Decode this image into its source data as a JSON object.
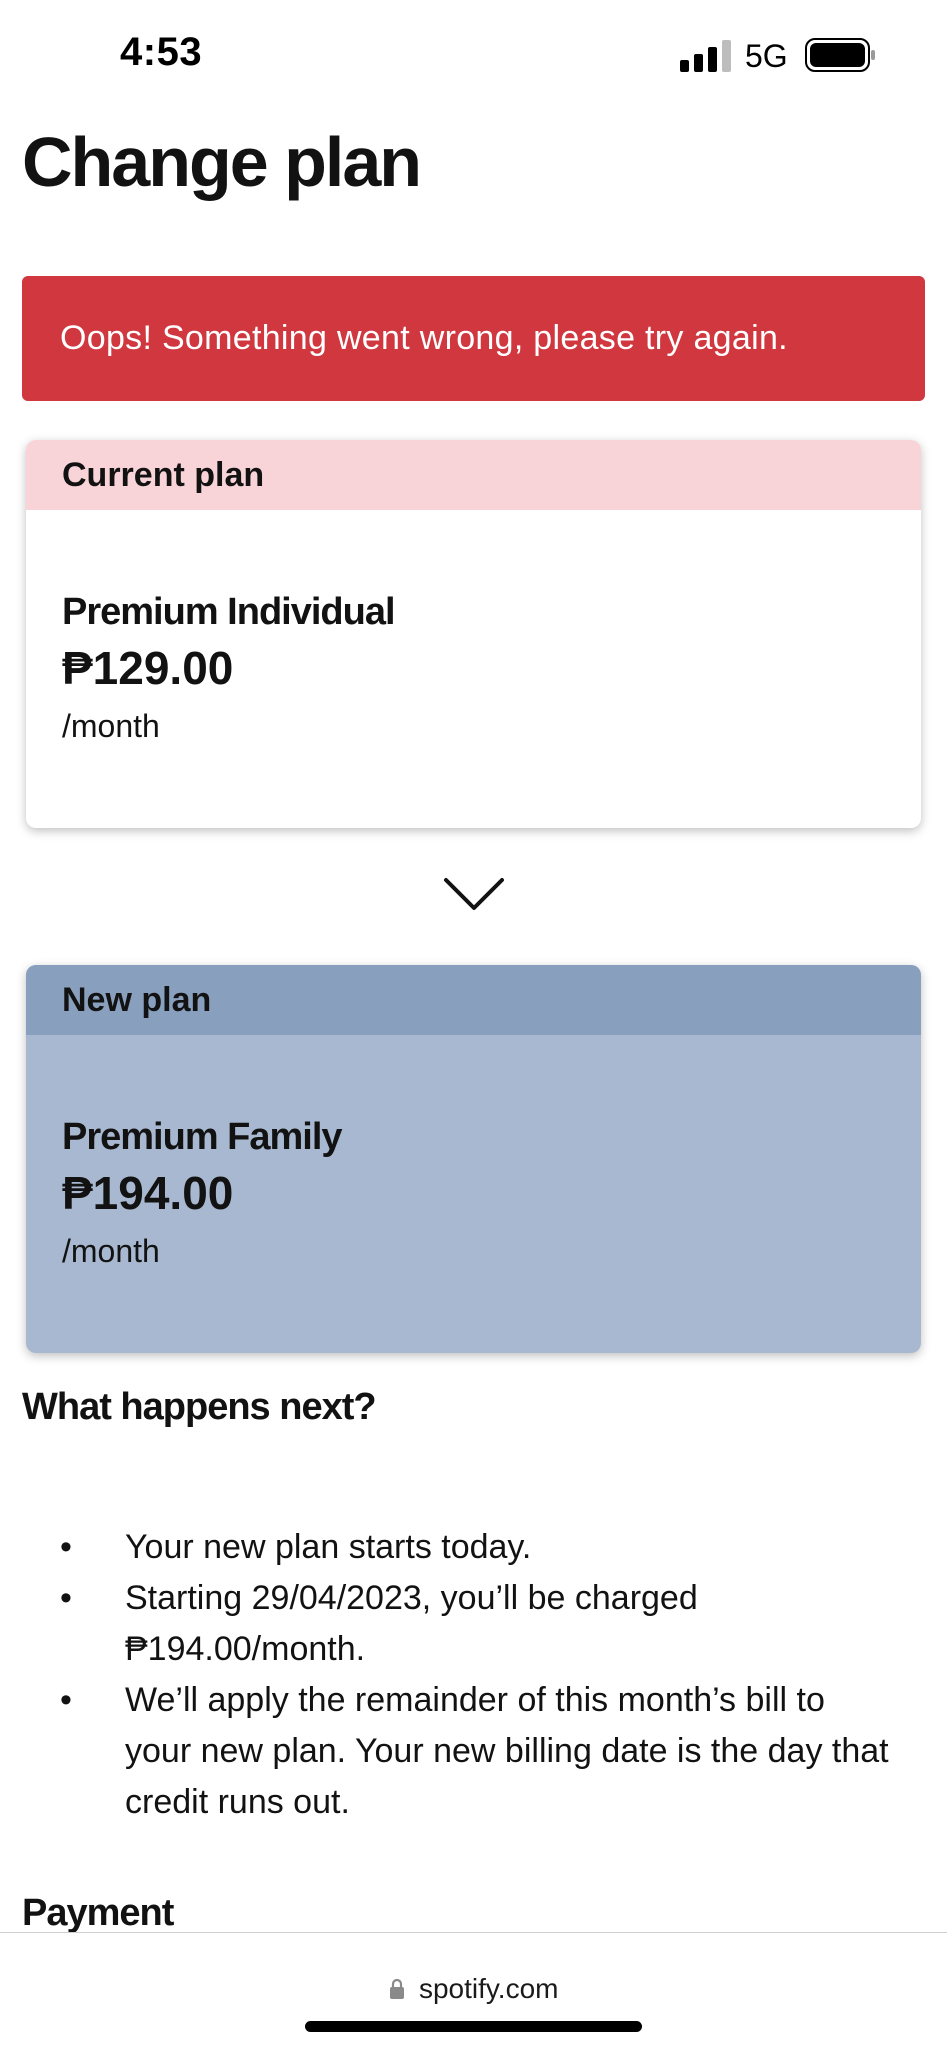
{
  "status_bar": {
    "time": "4:53",
    "network": "5G",
    "signal_icon": "signal-bars-icon",
    "battery_icon": "battery-icon"
  },
  "page": {
    "title": "Change plan"
  },
  "error": {
    "message": "Oops! Something went wrong, please try again.",
    "color": "#d0373f"
  },
  "current_plan": {
    "header": "Current plan",
    "name": "Premium Individual",
    "price": "₱129.00",
    "period": "/month",
    "header_color": "#f8d3d7"
  },
  "arrow_icon": "chevron-down-icon",
  "new_plan": {
    "header": "New plan",
    "name": "Premium Family",
    "price": "₱194.00",
    "period": "/month",
    "header_color": "#889fbe",
    "body_color": "#a8b8d0"
  },
  "next_steps": {
    "heading": "What happens next?",
    "items": [
      "Your new plan starts today.",
      "Starting 29/04/2023, you’ll be charged ₱194.00/month.",
      "We’ll apply the remainder of this month’s bill to your new plan. Your new billing date is the day that credit runs out."
    ]
  },
  "payment": {
    "heading": "Payment"
  },
  "browser": {
    "url": "spotify.com",
    "lock_icon": "lock-icon"
  }
}
